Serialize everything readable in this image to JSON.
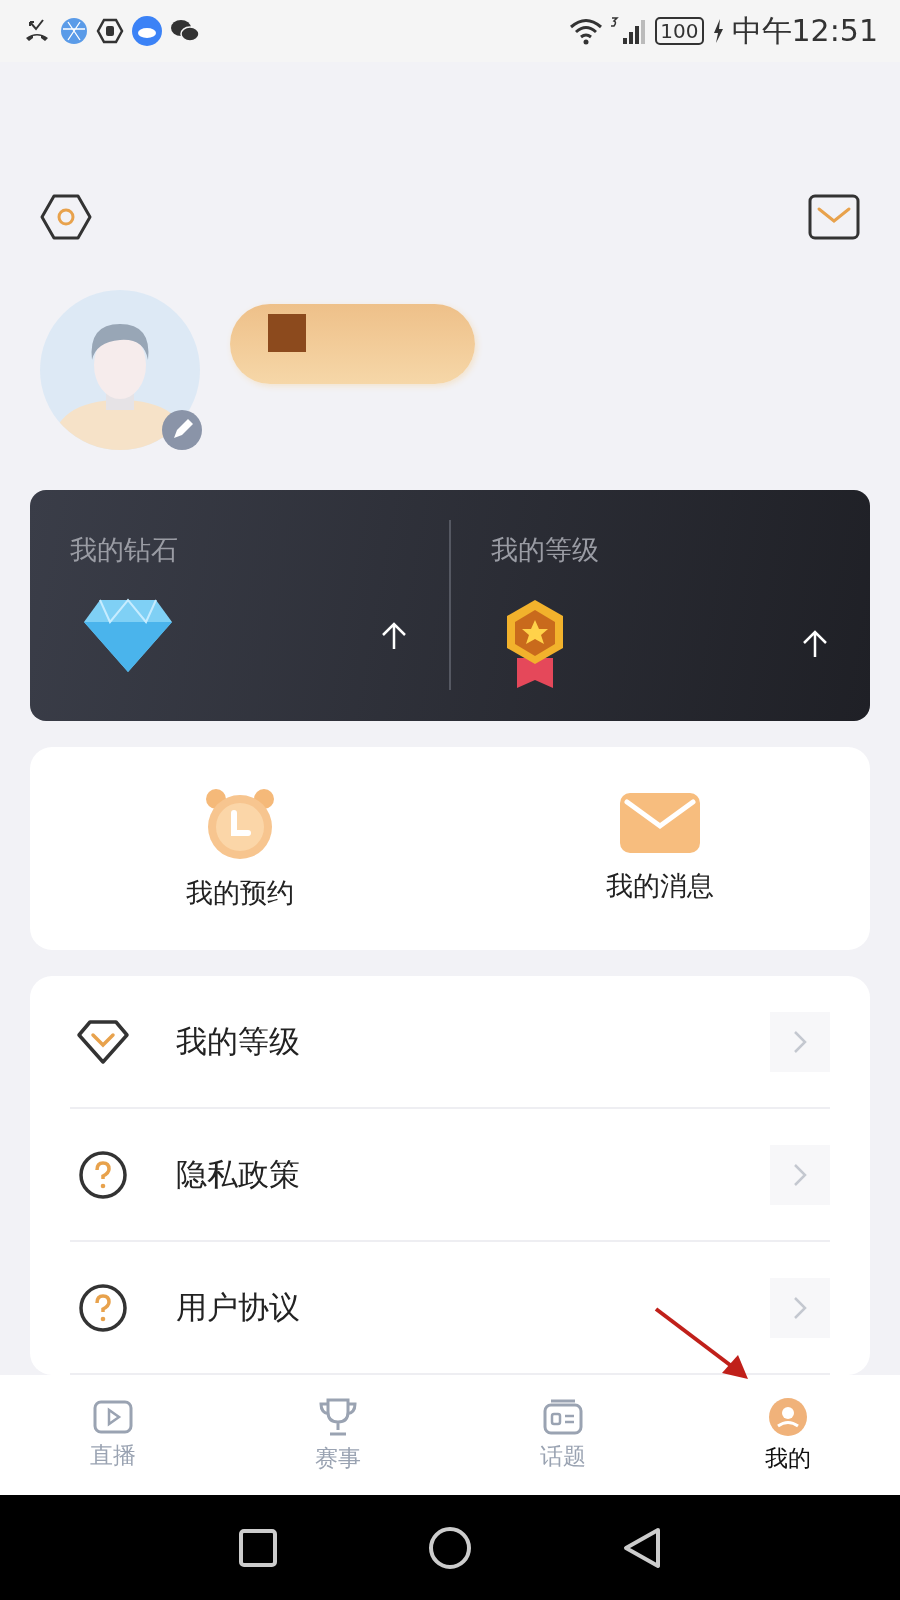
{
  "status_bar": {
    "time": "中午12:51",
    "battery": "100"
  },
  "cards": {
    "diamonds": {
      "title": "我的钻石"
    },
    "level": {
      "title": "我的等级"
    }
  },
  "shortcuts": [
    {
      "kind": "alarm",
      "label": "我的预约"
    },
    {
      "kind": "mail",
      "label": "我的消息"
    }
  ],
  "menu": [
    {
      "kind": "level",
      "label": "我的等级"
    },
    {
      "kind": "help",
      "label": "隐私政策"
    },
    {
      "kind": "help",
      "label": "用户协议"
    }
  ],
  "tabs": [
    {
      "kind": "play",
      "label": "直播",
      "selected": false
    },
    {
      "kind": "trophy",
      "label": "赛事",
      "selected": false
    },
    {
      "kind": "topic",
      "label": "话题",
      "selected": false
    },
    {
      "kind": "me",
      "label": "我的",
      "selected": true
    }
  ]
}
